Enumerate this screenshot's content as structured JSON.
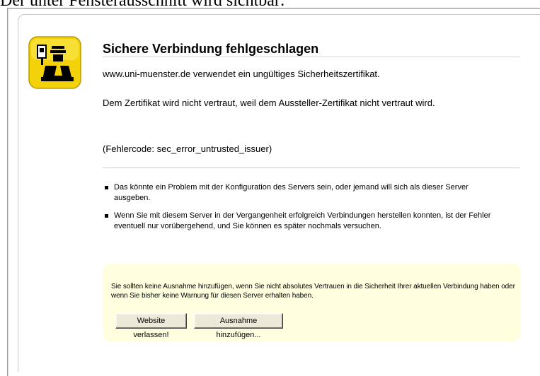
{
  "caption": "Der unter Fensterausschnitt wird sichtbar:",
  "error": {
    "title": "Sichere Verbindung fehlgeschlagen",
    "site_message": "www.uni-muenster.de verwendet ein ungültiges Sicherheitszertifikat.",
    "explanation": "Dem Zertifikat wird nicht vertraut, weil dem Aussteller-Zertifikat nicht vertraut wird.",
    "error_code": "(Fehlercode: sec_error_untrusted_issuer)"
  },
  "bullets": [
    "Das könnte ein Problem mit der Konfiguration des Servers sein, oder jemand will sich als dieser Server ausgeben.",
    "Wenn Sie mit diesem Server in der Vergangenheit erfolgreich Verbindungen herstellen konnten, ist der Fehler eventuell nur vorübergehend, und Sie können es später nochmals versuchen."
  ],
  "warning": {
    "text": "Sie sollten keine Ausnahme hinzufügen, wenn Sie nicht absolutes Vertrauen in die Sicherheit Ihrer aktuellen Verbindung haben oder wenn Sie bisher keine Warnung für diesen Server erhalten haben.",
    "leave_button": "Website verlassen!",
    "add_exception_button": "Ausnahme hinzufügen..."
  },
  "colors": {
    "icon_yellow": "#f3d20a",
    "warning_background": "#ffffe0"
  },
  "icons": {
    "error_icon": "police-officer-badge-icon"
  }
}
